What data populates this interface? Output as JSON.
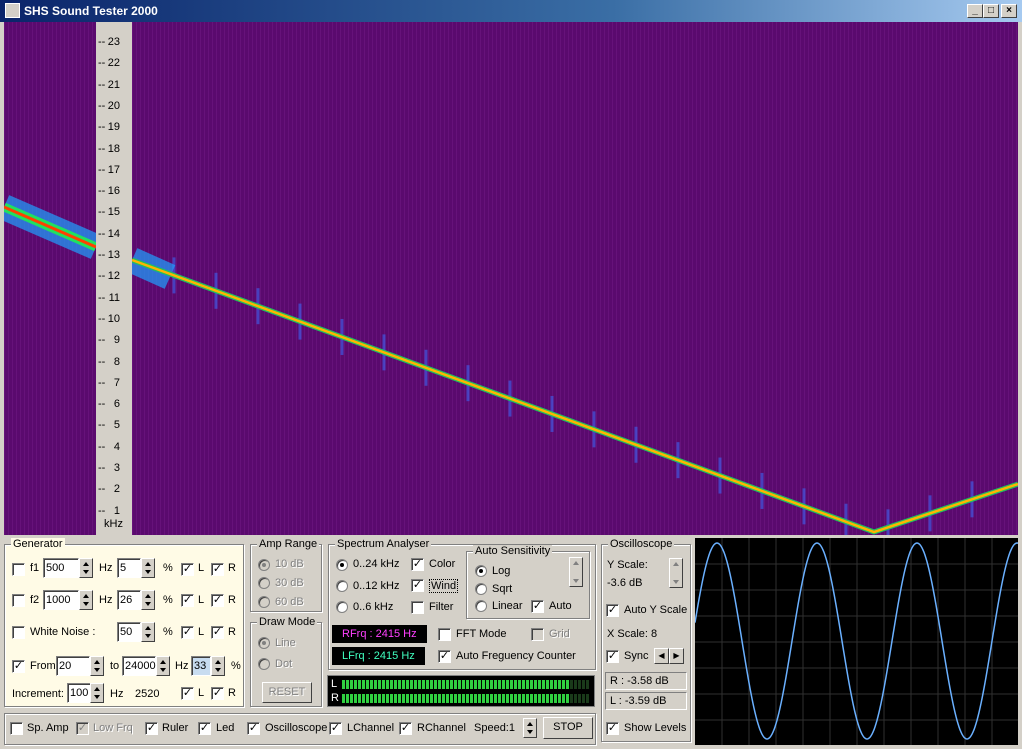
{
  "window": {
    "title": "SHS Sound Tester 2000",
    "minimize": "_",
    "maximize": "□",
    "close": "×"
  },
  "ruler": {
    "ticks": [
      "23",
      "22",
      "21",
      "20",
      "19",
      "18",
      "17",
      "16",
      "15",
      "14",
      "13",
      "12",
      "11",
      "10",
      "9",
      "8",
      "7",
      "6",
      "5",
      "4",
      "3",
      "2",
      "1"
    ],
    "unit": "kHz"
  },
  "generator": {
    "title": "Generator",
    "f1": {
      "label": "f1",
      "value": "500",
      "unit": "Hz",
      "level": "5",
      "pct": "%",
      "L": "L",
      "R": "R"
    },
    "f2": {
      "label": "f2",
      "value": "1000",
      "unit": "Hz",
      "level": "26",
      "pct": "%",
      "L": "L",
      "R": "R"
    },
    "noise": {
      "label": "White Noise :",
      "level": "50",
      "pct": "%",
      "L": "L",
      "R": "R"
    },
    "sweep": {
      "from_label": "From",
      "from": "20",
      "to_label": "to",
      "to": "24000",
      "unit": "Hz",
      "level": "33",
      "pct": "%"
    },
    "increment": {
      "label": "Increment:",
      "value": "100",
      "unit": "Hz",
      "current": "2520",
      "L": "L",
      "R": "R"
    }
  },
  "amp_range": {
    "title": "Amp Range",
    "options": [
      "10 dB",
      "30 dB",
      "60 dB"
    ]
  },
  "draw_mode": {
    "title": "Draw Mode",
    "options": [
      "Line",
      "Dot"
    ],
    "reset": "RESET"
  },
  "spectrum": {
    "title": "Spectrum Analyser",
    "ranges": [
      "0..24 kHz",
      "0..12 kHz",
      "0..6 kHz"
    ],
    "color": "Color",
    "wind": "Wind",
    "filter": "Filter",
    "rfrq": "RFrq : 2415 Hz",
    "lfrq": "LFrq : 2415 Hz",
    "fft": "FFT Mode",
    "grid": "Grid",
    "afc": "Auto Freguency Counter"
  },
  "auto_sens": {
    "title": "Auto Sensitivity",
    "options": [
      "Log",
      "Sqrt",
      "Linear"
    ],
    "auto": "Auto"
  },
  "oscilloscope": {
    "title": "Oscilloscope",
    "yscale_label": "Y Scale:",
    "yscale": "-3.6 dB",
    "auto_y": "Auto Y Scale",
    "xscale": "X Scale: 8",
    "sync": "Sync",
    "r_level": "R : -3.58 dB",
    "l_level": "L : -3.59 dB",
    "show_levels": "Show Levels"
  },
  "meter": {
    "L": "L",
    "R": "R",
    "level_l": 0.92,
    "level_r": 0.92
  },
  "bottom": {
    "sp_amp": "Sp. Amp",
    "low_frq": "Low Frq",
    "ruler": "Ruler",
    "led": "Led",
    "oscilloscope": "Oscilloscope",
    "lchannel": "LChannel",
    "rchannel": "RChannel",
    "speed": "Speed:1",
    "stop": "STOP"
  },
  "colors": {
    "spectrogram_bg": "#5a0a6e",
    "trace": "#ffb400",
    "wave": "#6ab0ff",
    "rfrq": "#ff40ff",
    "lfrq": "#40ffc0"
  }
}
